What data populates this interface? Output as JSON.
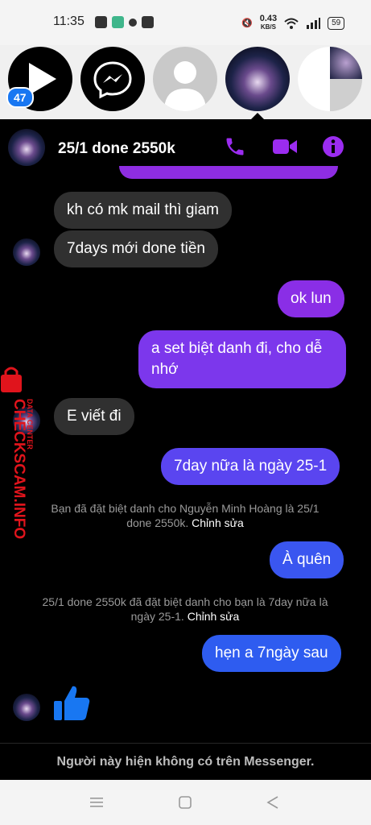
{
  "status": {
    "time": "11:35",
    "net_speed": "0.43",
    "net_unit": "KB/S",
    "battery": "59"
  },
  "bubbles": {
    "badge": "47"
  },
  "header": {
    "name": "25/1 done 2550k"
  },
  "messages": [
    {
      "dir": "in",
      "text": "kh có mk mail thì giam"
    },
    {
      "dir": "in",
      "text": "7days mới done tiền"
    },
    {
      "dir": "out",
      "text": "ok lun"
    },
    {
      "dir": "out",
      "text": "a set biệt danh đi, cho dễ nhớ"
    },
    {
      "dir": "in",
      "text": "E viết đi"
    },
    {
      "dir": "out",
      "text": "7day nữa là ngày 25-1"
    },
    {
      "dir": "out",
      "text": "À quên"
    },
    {
      "dir": "out",
      "text": "hẹn a 7ngày sau"
    }
  ],
  "system": [
    {
      "text": "Bạn đã đặt biệt danh cho Nguyễn Minh Hoàng là 25/1 done 2550k.",
      "link": "Chỉnh sửa"
    },
    {
      "text": "25/1 done 2550k đã đặt biệt danh cho bạn là 7day nữa là ngày 25-1.",
      "link": "Chỉnh sửa"
    }
  ],
  "footer": {
    "text": "Người này hiện không có trên Messenger."
  },
  "watermark": {
    "line1": "CHECKSCAM.INFO",
    "line2": "DATA CENTER"
  },
  "colors": {
    "accent": "#9b2cf0",
    "bubble_in": "#303030",
    "bubble_out_top": "#8e2de2",
    "bubble_out_bottom": "#2e5cf0",
    "like": "#1877f2"
  },
  "icons": [
    "play-icon",
    "messenger-icon",
    "phone-icon",
    "video-icon",
    "info-icon",
    "like-icon",
    "lock-icon",
    "menu-icon",
    "home-icon",
    "back-icon"
  ]
}
